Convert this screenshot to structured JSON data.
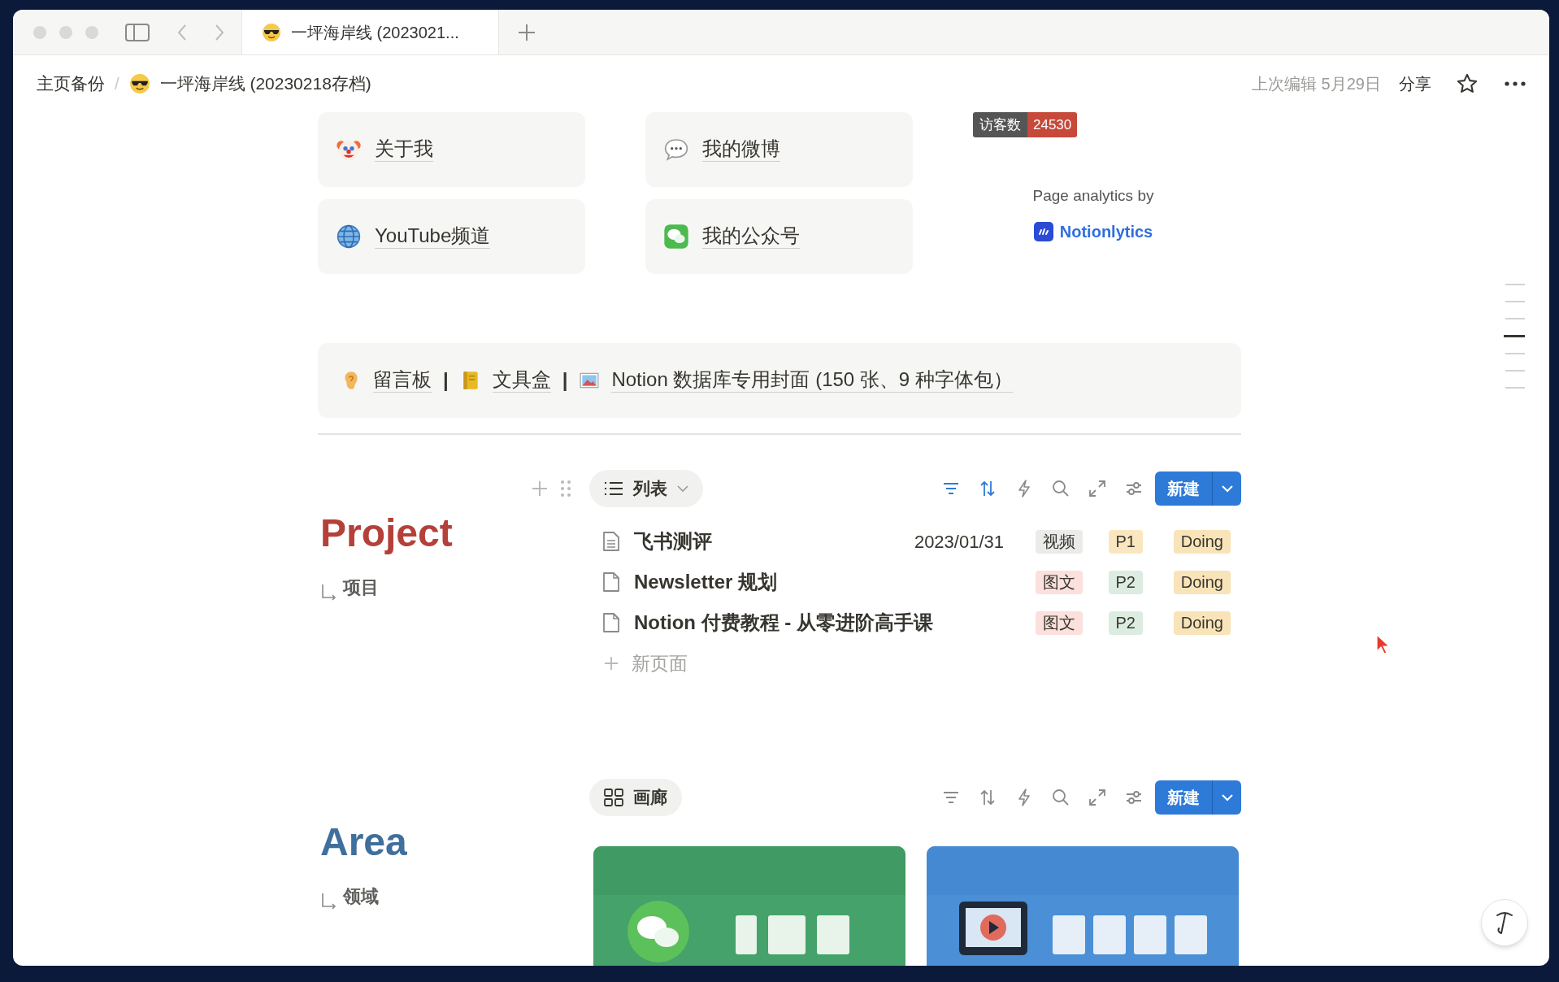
{
  "tab_bar": {
    "tab_title": "一坪海岸线 (2023021..."
  },
  "breadcrumb": {
    "items": [
      {
        "kind": "text",
        "text": "主页备份"
      },
      {
        "kind": "emoji-page",
        "text": "一坪海岸线 (20230218存档)"
      }
    ],
    "separator": "/"
  },
  "header_actions": {
    "last_edited": "上次编辑 5月29日",
    "share": "分享"
  },
  "link_cards": [
    {
      "label": "关于我"
    },
    {
      "label": "我的微博"
    },
    {
      "label": "YouTube频道"
    },
    {
      "label": "我的公众号"
    }
  ],
  "visitor_badge": {
    "label": "访客数",
    "count": "24530"
  },
  "analytics": {
    "caption": "Page analytics by",
    "brand": "Notionlytics"
  },
  "callout": {
    "items": [
      {
        "kind": "link",
        "text": "留言板"
      },
      {
        "kind": "separator",
        "text": "|"
      },
      {
        "kind": "link",
        "text": "文具盒"
      },
      {
        "kind": "separator",
        "text": "|"
      },
      {
        "kind": "link",
        "text": "Notion 数据库专用封面 (150 张、9 种字体包）"
      }
    ]
  },
  "databases": [
    {
      "title": "Project",
      "color": "#b5403a",
      "subtitle": "项目",
      "view": {
        "kind": "list",
        "label": "列表",
        "dropdown": true
      },
      "sort_filter_active": true,
      "new_button": "新建",
      "new_page": "新页面",
      "rows": [
        {
          "kind": "text-page",
          "title": "飞书测评",
          "date": "2023/01/31",
          "tags": [
            {
              "text": "视频",
              "color": "#ebebea"
            },
            {
              "text": "P1",
              "color": "#fbe7bf"
            },
            {
              "text": "Doing",
              "color": "#f8e4b8"
            }
          ]
        },
        {
          "kind": "empty-page",
          "title": "Newsletter 规划",
          "tags": [
            {
              "text": "图文",
              "color": "#fbe0dd"
            },
            {
              "text": "P2",
              "color": "#dcece0"
            },
            {
              "text": "Doing",
              "color": "#f8e4b8"
            }
          ]
        },
        {
          "kind": "empty-page",
          "title": "Notion 付费教程 - 从零进阶高手课",
          "tags": [
            {
              "text": "图文",
              "color": "#fbe0dd"
            },
            {
              "text": "P2",
              "color": "#dcece0"
            },
            {
              "text": "Doing",
              "color": "#f8e4b8"
            }
          ]
        }
      ]
    },
    {
      "title": "Area",
      "color": "#3f6f9c",
      "subtitle": "领域",
      "view": {
        "kind": "gallery",
        "label": "画廊",
        "dropdown": false
      },
      "sort_filter_active": false,
      "new_button": "新建"
    }
  ]
}
